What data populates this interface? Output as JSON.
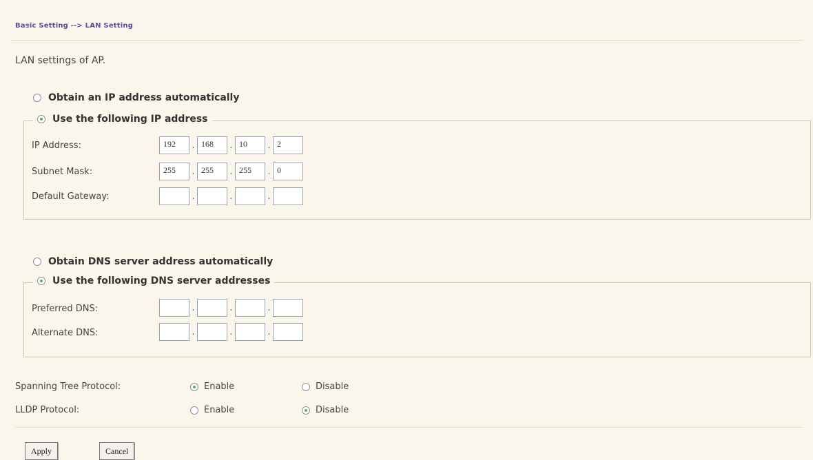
{
  "breadcrumb": "Basic Setting --> LAN Setting",
  "description": "LAN settings of AP.",
  "ip_section": {
    "auto_label": "Obtain an IP address automatically",
    "manual_label": "Use the following IP address",
    "auto_selected": false,
    "manual_selected": true,
    "rows": [
      {
        "label": "IP Address:",
        "octets": [
          "192",
          "168",
          "10",
          "2"
        ]
      },
      {
        "label": "Subnet Mask:",
        "octets": [
          "255",
          "255",
          "255",
          "0"
        ]
      },
      {
        "label": "Default Gateway:",
        "octets": [
          "",
          "",
          "",
          ""
        ]
      }
    ]
  },
  "dns_section": {
    "auto_label": "Obtain DNS server address automatically",
    "manual_label": "Use the following DNS server addresses",
    "auto_selected": false,
    "manual_selected": true,
    "rows": [
      {
        "label": "Preferred DNS:",
        "octets": [
          "",
          "",
          "",
          ""
        ]
      },
      {
        "label": "Alternate DNS:",
        "octets": [
          "",
          "",
          "",
          ""
        ]
      }
    ]
  },
  "protocols": [
    {
      "label": "Spanning Tree Protocol:",
      "enable_label": "Enable",
      "disable_label": "Disable",
      "value": "enable"
    },
    {
      "label": "LLDP Protocol:",
      "enable_label": "Enable",
      "disable_label": "Disable",
      "value": "disable"
    }
  ],
  "buttons": {
    "apply": "Apply",
    "cancel": "Cancel"
  },
  "ip_separator": "."
}
